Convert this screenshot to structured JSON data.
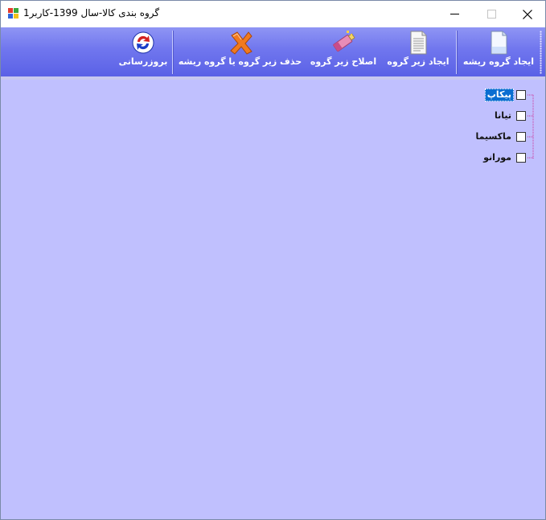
{
  "window": {
    "title": "گروه بندی کالا-سال 1399-کاربر1",
    "icon": "windows-app-icon"
  },
  "toolbar": {
    "buttons": [
      {
        "label": "ایجاد گروه ریشه",
        "icon": "new-document-icon"
      },
      {
        "label": "ایجاد زیر گروه",
        "icon": "lined-document-icon"
      },
      {
        "label": "اصلاح زیر گروه",
        "icon": "eraser-edit-icon"
      },
      {
        "label": "حذف زیر گروه یا گروه ریشه",
        "icon": "delete-x-icon"
      },
      {
        "label": "بروزرسانی",
        "icon": "refresh-icon"
      }
    ]
  },
  "tree": {
    "nodes": [
      {
        "label": "پیکاپ",
        "checked": false,
        "selected": true
      },
      {
        "label": "تیانا",
        "checked": false,
        "selected": false
      },
      {
        "label": "ماکسیما",
        "checked": false,
        "selected": false
      },
      {
        "label": "مورانو",
        "checked": false,
        "selected": false
      }
    ]
  },
  "colors": {
    "toolbar_top": "#8f95f4",
    "toolbar_bottom": "#5a61e6",
    "client_background": "#c0c0fe",
    "selection": "#0a6ed1",
    "tree_line": "#cc3399"
  }
}
